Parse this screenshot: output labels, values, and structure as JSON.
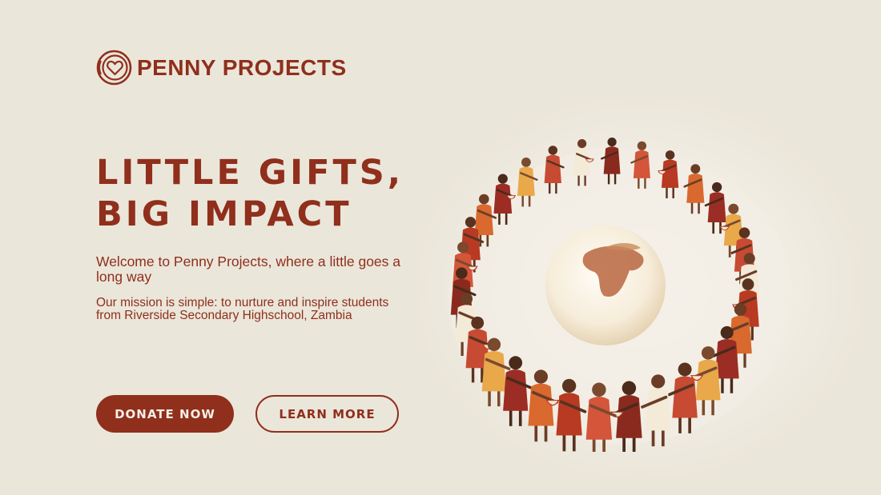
{
  "brand": {
    "name": "PENNY PROJECTS",
    "logo_icon": "coin-heart-icon"
  },
  "hero": {
    "headline_lines": [
      "LITTLE GIFTS,",
      "BIG IMPACT"
    ],
    "welcome": "Welcome to Penny Projects, where a little goes a long way",
    "mission": "Our mission is simple: to nurture and inspire students from Riverside Secondary Highschool, Zambia"
  },
  "buttons": {
    "donate": "DONATE NOW",
    "learn_more": "LEARN MORE"
  },
  "colors": {
    "background": "#ebe6da",
    "brand": "#8f2f1c",
    "button_text_light": "#f6efe6"
  },
  "illustration": {
    "icon": "community-circle-globe-illustration"
  }
}
